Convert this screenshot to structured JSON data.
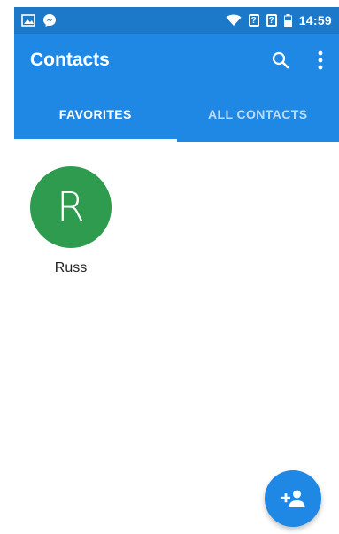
{
  "status_bar": {
    "left_icons": [
      "image-notification-icon",
      "messenger-icon"
    ],
    "sim1": "?",
    "sim2": "?",
    "time": "14:59"
  },
  "app_bar": {
    "title": "Contacts",
    "actions": [
      "search-icon",
      "more-vert-icon"
    ]
  },
  "tabs": [
    {
      "label": "FAVORITES",
      "active": true
    },
    {
      "label": "ALL CONTACTS",
      "active": false
    }
  ],
  "favorites": [
    {
      "initial": "R",
      "name": "Russ",
      "color": "#2e9b4f"
    }
  ],
  "fab": {
    "icon": "add-contact-icon"
  },
  "colors": {
    "status_bar": "#1c78c8",
    "primary": "#1f88e5",
    "avatar": "#2e9b4f"
  }
}
